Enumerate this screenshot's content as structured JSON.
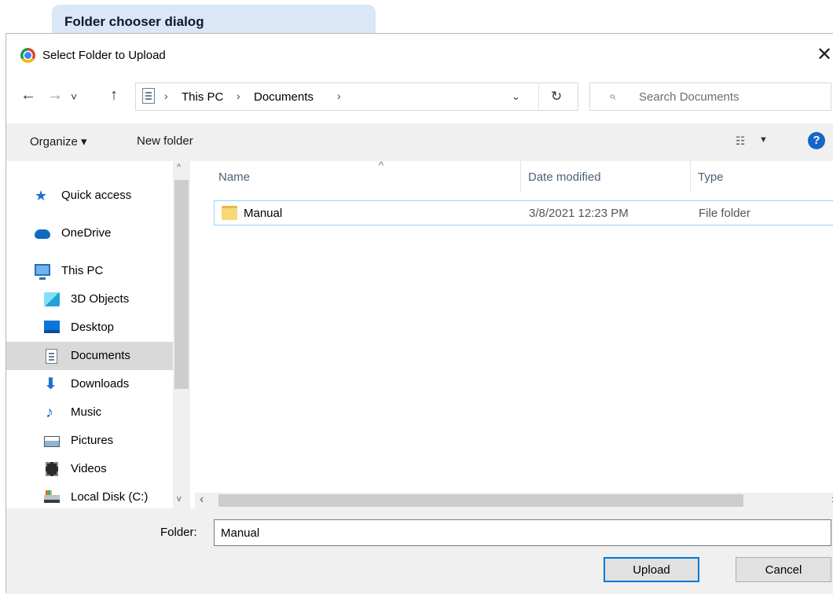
{
  "caption": "Folder chooser dialog",
  "window": {
    "title": "Select Folder to Upload",
    "close_glyph": "✕"
  },
  "nav": {
    "back_glyph": "←",
    "forward_glyph": "→",
    "recent_glyph": "˅",
    "up_glyph": "↑",
    "breadcrumb": [
      "This PC",
      "Documents"
    ],
    "crumb_separator": "›",
    "dropdown_glyph": "⌄",
    "refresh_glyph": "↻",
    "search_icon": "⌕",
    "search_placeholder": "Search Documents"
  },
  "commands": {
    "organize": "Organize ▾",
    "new_folder": "New folder",
    "view_icon": "☷",
    "view_arrow": "▼",
    "help": "?"
  },
  "sidebar": {
    "items": [
      {
        "label": "Quick access",
        "icon": "star-icon"
      },
      {
        "label": "OneDrive",
        "icon": "cloud-icon"
      },
      {
        "label": "This PC",
        "icon": "computer-icon"
      },
      {
        "label": "3D Objects",
        "icon": "cube-icon"
      },
      {
        "label": "Desktop",
        "icon": "desktop-icon"
      },
      {
        "label": "Documents",
        "icon": "documents-icon",
        "selected": true
      },
      {
        "label": "Downloads",
        "icon": "download-icon"
      },
      {
        "label": "Music",
        "icon": "music-note-icon"
      },
      {
        "label": "Pictures",
        "icon": "pictures-icon"
      },
      {
        "label": "Videos",
        "icon": "film-icon"
      },
      {
        "label": "Local Disk (C:)",
        "icon": "disk-icon"
      }
    ],
    "star_glyph": "★",
    "download_glyph": "⬇",
    "music_glyph": "♪",
    "scroll_up": "^",
    "scroll_down": "v"
  },
  "filelist": {
    "columns": [
      "Name",
      "Date modified",
      "Type"
    ],
    "sort_glyph": "^",
    "rows": [
      {
        "name": "Manual",
        "date": "3/8/2021 12:23 PM",
        "type": "File folder"
      }
    ],
    "scroll_left": "‹",
    "scroll_right": "›"
  },
  "footer": {
    "folder_label": "Folder:",
    "folder_value": "Manual",
    "upload": "Upload",
    "cancel": "Cancel"
  },
  "colors": {
    "accent": "#0078d7",
    "selection": "#d9d9d9",
    "row_border": "#99d1ff",
    "caption_bg": "#dbe6f6"
  }
}
